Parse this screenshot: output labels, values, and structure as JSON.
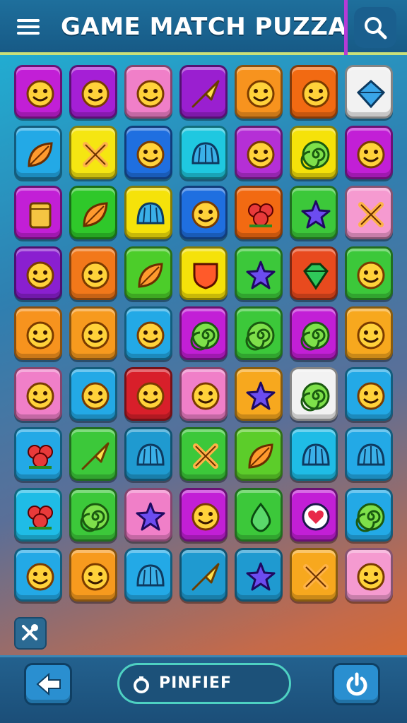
{
  "header": {
    "title": "GAME MATCH PUZZA",
    "menu_icon": "hamburger-menu-icon",
    "search_icon": "search-icon"
  },
  "board": {
    "rows": 9,
    "cols": 7,
    "tiles": [
      [
        {
          "color": "#c21fd6",
          "icon": "face"
        },
        {
          "color": "#a51fd6",
          "icon": "face"
        },
        {
          "color": "#f07fc8",
          "icon": "face"
        },
        {
          "color": "#9a1fd0",
          "icon": "arrow"
        },
        {
          "color": "#f7931e",
          "icon": "face"
        },
        {
          "color": "#f26a12",
          "icon": "face"
        },
        {
          "color": "#f2f2f2",
          "icon": "diamond"
        }
      ],
      [
        {
          "color": "#23a9e6",
          "icon": "leaf"
        },
        {
          "color": "#f5e612",
          "icon": "cross"
        },
        {
          "color": "#1f6fe0",
          "icon": "face"
        },
        {
          "color": "#1fc8e0",
          "icon": "shell"
        },
        {
          "color": "#b52fd6",
          "icon": "face"
        },
        {
          "color": "#f5e20a",
          "icon": "spiral"
        },
        {
          "color": "#c21fd6",
          "icon": "face"
        }
      ],
      [
        {
          "color": "#c21fd6",
          "icon": "block"
        },
        {
          "color": "#2fc82a",
          "icon": "leaf"
        },
        {
          "color": "#f5e20a",
          "icon": "shell"
        },
        {
          "color": "#1f6fe0",
          "icon": "face"
        },
        {
          "color": "#f26a12",
          "icon": "flower"
        },
        {
          "color": "#3cc83a",
          "icon": "star"
        },
        {
          "color": "#f59ad0",
          "icon": "cross"
        }
      ],
      [
        {
          "color": "#8a1fd0",
          "icon": "face"
        },
        {
          "color": "#f2781a",
          "icon": "face"
        },
        {
          "color": "#4ccd2a",
          "icon": "leaf"
        },
        {
          "color": "#f5e20a",
          "icon": "shield"
        },
        {
          "color": "#3cc83a",
          "icon": "star"
        },
        {
          "color": "#e84a1e",
          "icon": "gem"
        },
        {
          "color": "#3cc83a",
          "icon": "face"
        }
      ],
      [
        {
          "color": "#f7931e",
          "icon": "face"
        },
        {
          "color": "#f79a1e",
          "icon": "face"
        },
        {
          "color": "#23a9e6",
          "icon": "face"
        },
        {
          "color": "#c21fd6",
          "icon": "spiral"
        },
        {
          "color": "#3cc83a",
          "icon": "spiral"
        },
        {
          "color": "#c21fd6",
          "icon": "spiral"
        },
        {
          "color": "#f7a81e",
          "icon": "face"
        }
      ],
      [
        {
          "color": "#f07fc8",
          "icon": "face"
        },
        {
          "color": "#23a9e6",
          "icon": "face"
        },
        {
          "color": "#d81f2a",
          "icon": "face"
        },
        {
          "color": "#f07fc8",
          "icon": "face"
        },
        {
          "color": "#f7a81e",
          "icon": "star"
        },
        {
          "color": "#f2f2f2",
          "icon": "spiral"
        },
        {
          "color": "#23a9e6",
          "icon": "face"
        }
      ],
      [
        {
          "color": "#23a9e6",
          "icon": "flower"
        },
        {
          "color": "#3cc83a",
          "icon": "arrow"
        },
        {
          "color": "#1f9ad0",
          "icon": "shell"
        },
        {
          "color": "#3cc83a",
          "icon": "cross"
        },
        {
          "color": "#5ccd2a",
          "icon": "leaf"
        },
        {
          "color": "#1fbce6",
          "icon": "shell"
        },
        {
          "color": "#23a9e6",
          "icon": "shell"
        }
      ],
      [
        {
          "color": "#1fbce6",
          "icon": "flower"
        },
        {
          "color": "#3cc83a",
          "icon": "spiral"
        },
        {
          "color": "#f07fc8",
          "icon": "star"
        },
        {
          "color": "#c21fd6",
          "icon": "face"
        },
        {
          "color": "#3cc83a",
          "icon": "drop"
        },
        {
          "color": "#c21fd6",
          "icon": "heart"
        },
        {
          "color": "#23a9e6",
          "icon": "spiral"
        }
      ],
      [
        {
          "color": "#23a9e6",
          "icon": "face"
        },
        {
          "color": "#f79a1e",
          "icon": "face"
        },
        {
          "color": "#23a9e6",
          "icon": "shell"
        },
        {
          "color": "#1f9ad0",
          "icon": "arrow"
        },
        {
          "color": "#1f9ad0",
          "icon": "star"
        },
        {
          "color": "#f7a81e",
          "icon": "cross"
        },
        {
          "color": "#f59ad0",
          "icon": "face"
        }
      ]
    ]
  },
  "side_tool": {
    "icon": "crossed-tools-icon"
  },
  "footer": {
    "back_icon": "back-arrow-icon",
    "center_label": "PINFIEF",
    "center_icon": "ring-icon",
    "power_icon": "power-icon"
  }
}
